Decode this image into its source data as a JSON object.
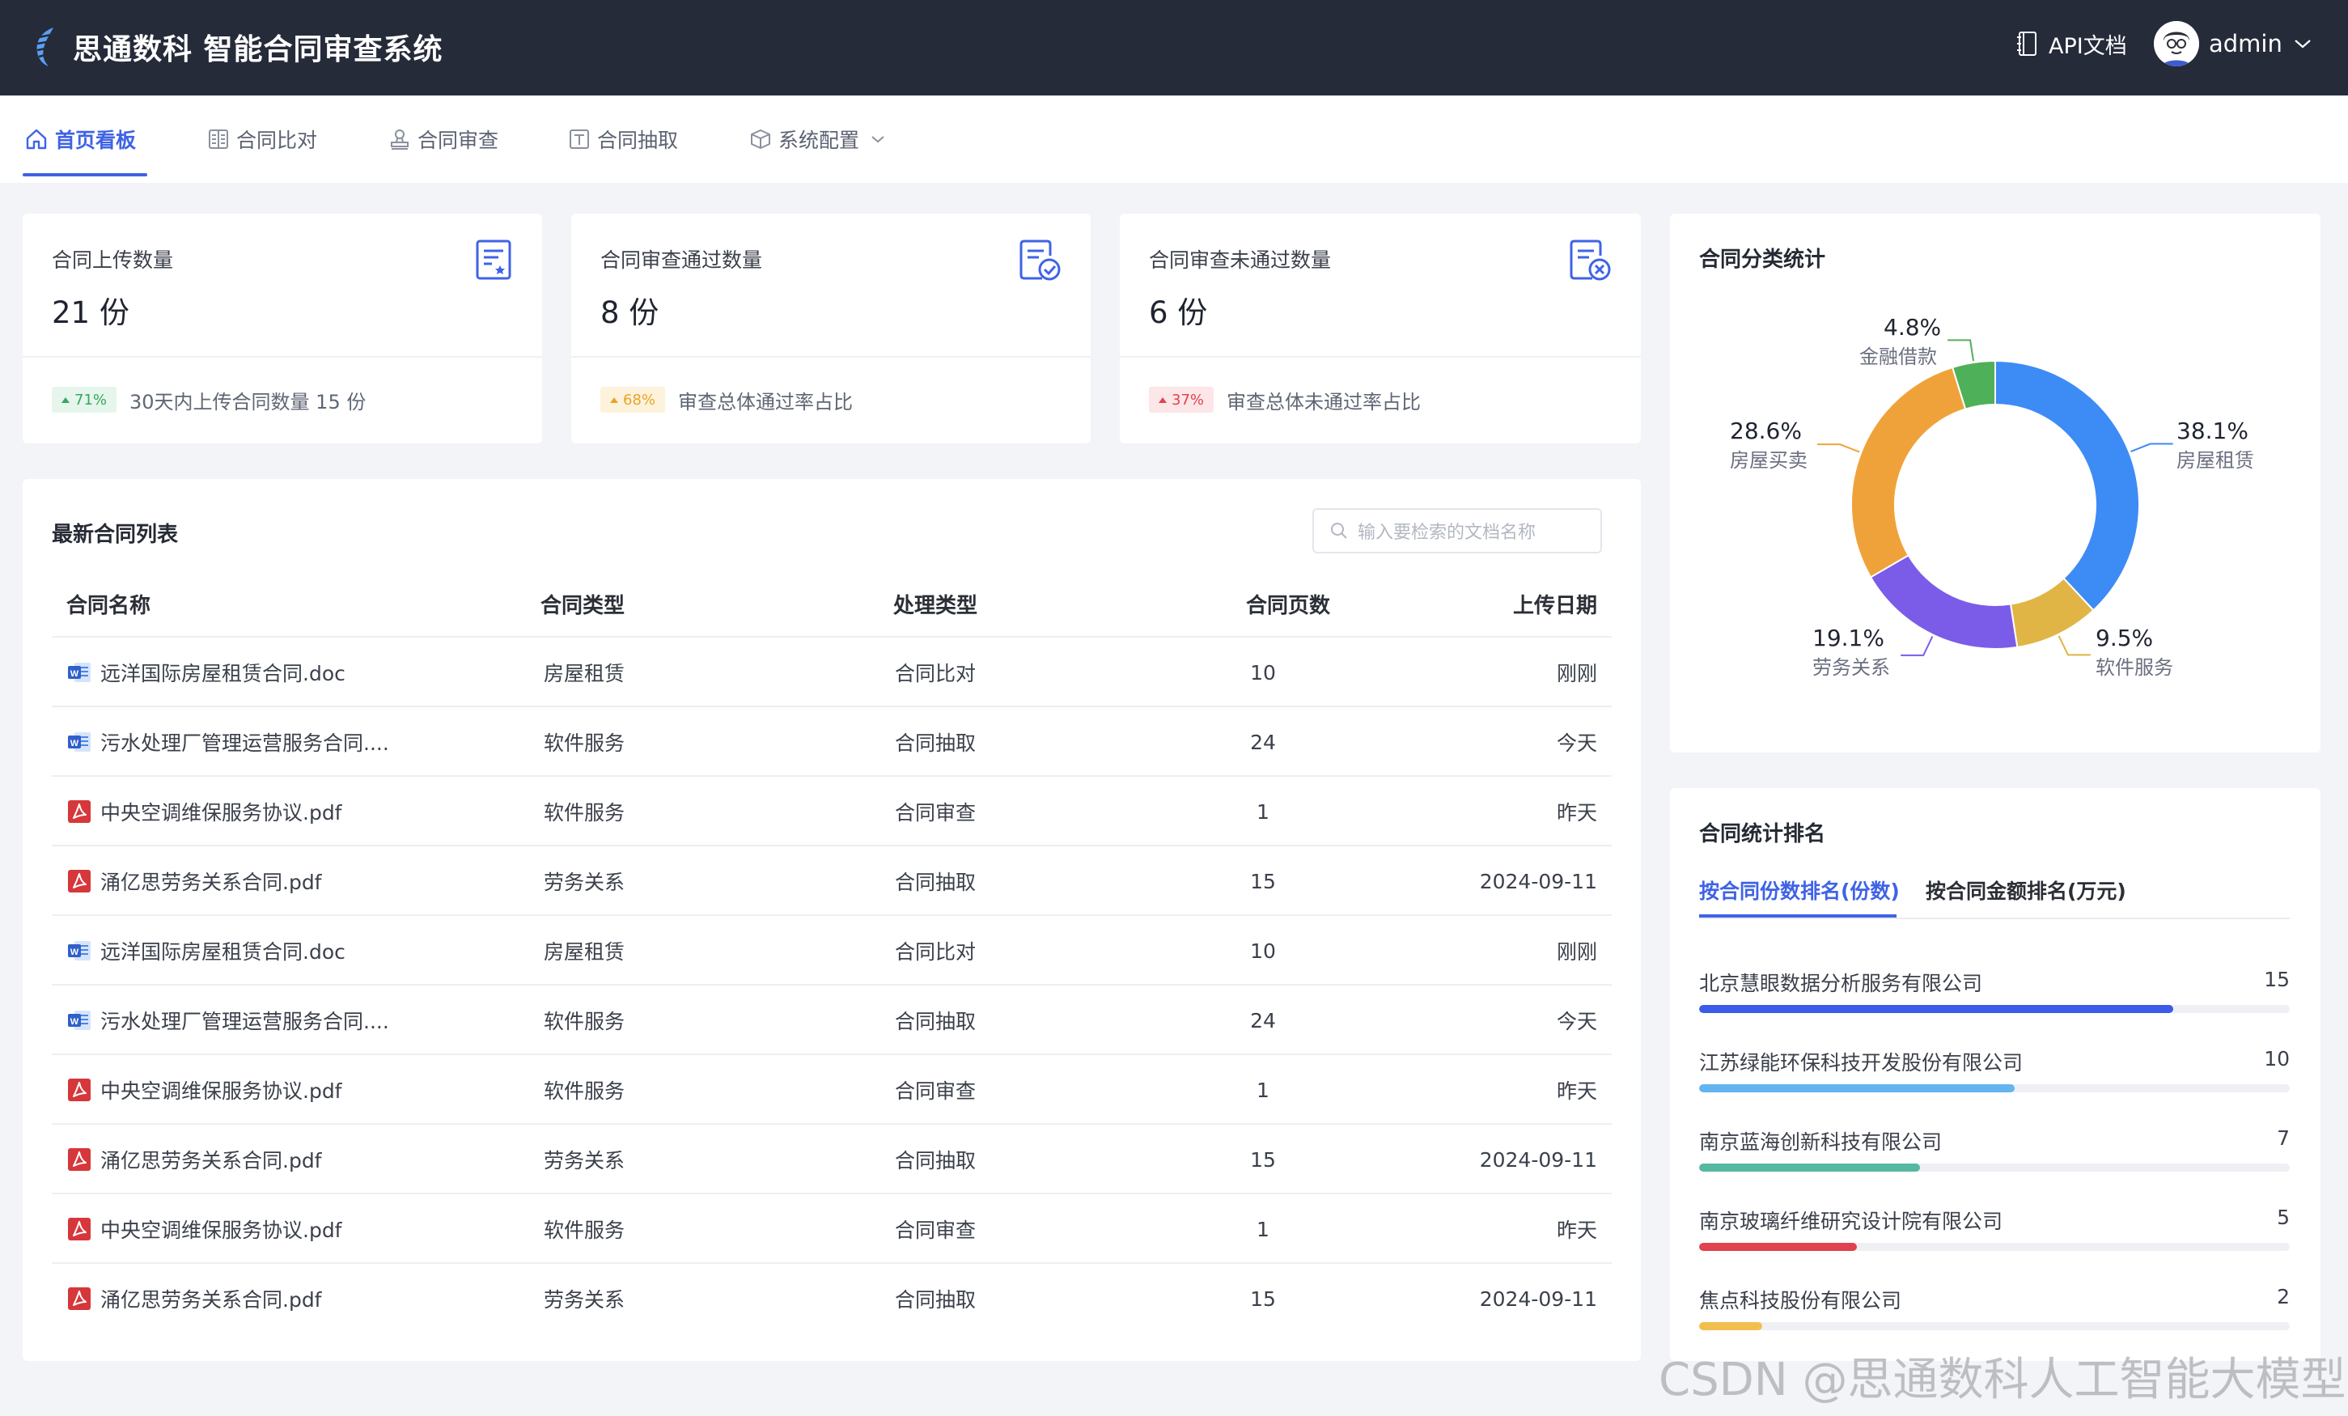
{
  "header": {
    "title": "思通数科 智能合同审查系统",
    "api_doc": "API文档",
    "user": "admin"
  },
  "nav": [
    {
      "label": "首页看板",
      "icon": "home-icon",
      "active": true
    },
    {
      "label": "合同比对",
      "icon": "compare-icon",
      "active": false
    },
    {
      "label": "合同审查",
      "icon": "stamp-icon",
      "active": false
    },
    {
      "label": "合同抽取",
      "icon": "extract-icon",
      "active": false
    },
    {
      "label": "系统配置",
      "icon": "box-icon",
      "active": false
    }
  ],
  "stats": [
    {
      "title": "合同上传数量",
      "value": "21 份",
      "badge": "71%",
      "badge_color": "#35a760",
      "desc": "30天内上传合同数量 15 份",
      "icon": "document-star-icon"
    },
    {
      "title": "合同审查通过数量",
      "value": "8 份",
      "badge": "68%",
      "badge_color": "#e8a428",
      "desc": "审查总体通过率占比",
      "icon": "document-check-icon"
    },
    {
      "title": "合同审查未通过数量",
      "value": "6 份",
      "badge": "37%",
      "badge_color": "#e0424f",
      "desc": "审查总体未通过率占比",
      "icon": "document-reject-icon"
    }
  ],
  "contracts": {
    "title": "最新合同列表",
    "search_placeholder": "输入要检索的文档名称",
    "columns": [
      "合同名称",
      "合同类型",
      "处理类型",
      "合同页数",
      "上传日期"
    ],
    "rows": [
      {
        "name": "远洋国际房屋租赁合同.doc",
        "type": "房屋租赁",
        "process": "合同比对",
        "pages": "10",
        "date": "刚刚",
        "file": "word"
      },
      {
        "name": "污水处理厂管理运营服务合同....",
        "type": "软件服务",
        "process": "合同抽取",
        "pages": "24",
        "date": "今天",
        "file": "word"
      },
      {
        "name": "中央空调维保服务协议.pdf",
        "type": "软件服务",
        "process": "合同审查",
        "pages": "1",
        "date": "昨天",
        "file": "pdf"
      },
      {
        "name": "涌亿思劳务关系合同.pdf",
        "type": "劳务关系",
        "process": "合同抽取",
        "pages": "15",
        "date": "2024-09-11",
        "file": "pdf"
      },
      {
        "name": "远洋国际房屋租赁合同.doc",
        "type": "房屋租赁",
        "process": "合同比对",
        "pages": "10",
        "date": "刚刚",
        "file": "word"
      },
      {
        "name": "污水处理厂管理运营服务合同....",
        "type": "软件服务",
        "process": "合同抽取",
        "pages": "24",
        "date": "今天",
        "file": "word"
      },
      {
        "name": "中央空调维保服务协议.pdf",
        "type": "软件服务",
        "process": "合同审查",
        "pages": "1",
        "date": "昨天",
        "file": "pdf"
      },
      {
        "name": "涌亿思劳务关系合同.pdf",
        "type": "劳务关系",
        "process": "合同抽取",
        "pages": "15",
        "date": "2024-09-11",
        "file": "pdf"
      },
      {
        "name": "中央空调维保服务协议.pdf",
        "type": "软件服务",
        "process": "合同审查",
        "pages": "1",
        "date": "昨天",
        "file": "pdf"
      },
      {
        "name": "涌亿思劳务关系合同.pdf",
        "type": "劳务关系",
        "process": "合同抽取",
        "pages": "15",
        "date": "2024-09-11",
        "file": "pdf"
      }
    ]
  },
  "category": {
    "title": "合同分类统计",
    "chart_data": {
      "type": "pie",
      "donut": true,
      "slices": [
        {
          "name": "房屋租赁",
          "value": 38.1,
          "label": "38.1%",
          "color": "#3d8bf5"
        },
        {
          "name": "软件服务",
          "value": 9.5,
          "label": "9.5%",
          "color": "#e1b545"
        },
        {
          "name": "劳务关系",
          "value": 19.1,
          "label": "19.1%",
          "color": "#7b5ce8"
        },
        {
          "name": "房屋买卖",
          "value": 28.6,
          "label": "28.6%",
          "color": "#f0a23a"
        },
        {
          "name": "金融借款",
          "value": 4.8,
          "label": "4.8%",
          "color": "#4fb05a"
        }
      ]
    }
  },
  "ranking": {
    "title": "合同统计排名",
    "tabs": [
      "按合同份数排名(份数)",
      "按合同金额排名(万元)"
    ],
    "max": 18.7,
    "items": [
      {
        "name": "北京慧眼数据分析服务有限公司",
        "value": 15,
        "color": "#3a5ce6"
      },
      {
        "name": "江苏绿能环保科技开发股份有限公司",
        "value": 10,
        "color": "#63b4f0"
      },
      {
        "name": "南京蓝海创新科技有限公司",
        "value": 7,
        "color": "#55b8a0"
      },
      {
        "name": "南京玻璃纤维研究设计院有限公司",
        "value": 5,
        "color": "#e0424f"
      },
      {
        "name": "焦点科技股份有限公司",
        "value": 2,
        "color": "#f2bf4e"
      }
    ]
  },
  "watermark": "CSDN @思通数科人工智能大模型"
}
